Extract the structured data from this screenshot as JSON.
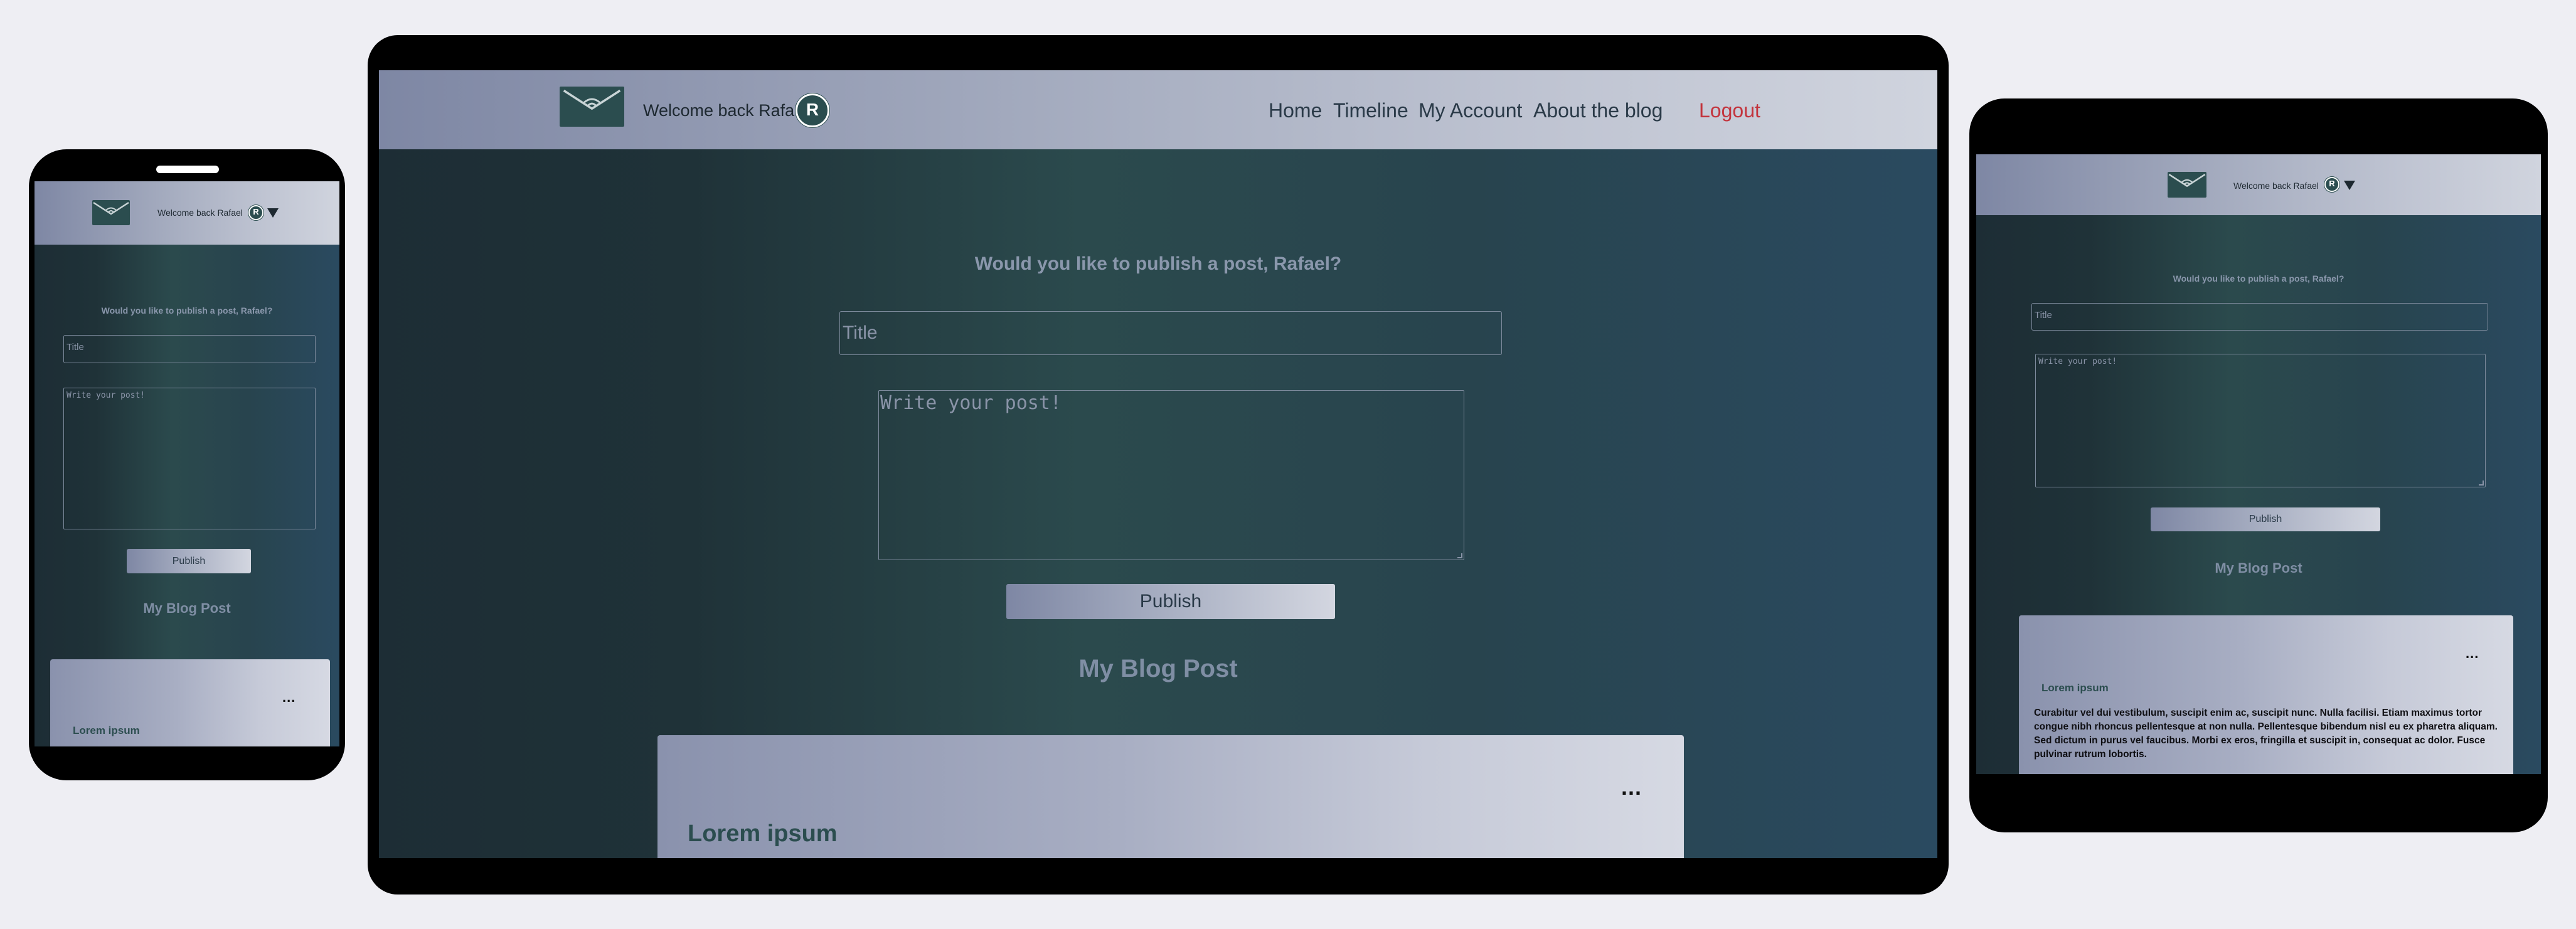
{
  "header": {
    "welcome": "Welcome back Rafael",
    "avatar_initial": "R",
    "nav": [
      "Home",
      "Timeline",
      "My Account",
      "About the blog"
    ],
    "logout": "Logout"
  },
  "form": {
    "question": "Would you like to publish a post, Rafael?",
    "title_placeholder": "Title",
    "post_placeholder": "Write your post!",
    "publish_label": "Publish"
  },
  "section": {
    "title": "My Blog Post"
  },
  "post": {
    "menu": "...",
    "title": "Lorem ipsum",
    "body": "Curabitur vel dui vestibulum, suscipit enim ac, suscipit nunc. Nulla facilisi. Etiam maximus tortor congue nibh rhoncus pellentesque at non nulla. Pellentesque bibendum nisl eu ex pharetra aliquam. Sed dictum in purus vel faucibus. Morbi ex eros, fringilla et suscipit in, consequat ac dolor. Fusce pulvinar rutrum lobortis."
  },
  "colors": {
    "accent": "#2b4d4f",
    "logout": "#c3343d",
    "frame": "#000000",
    "page": "#eeeef3"
  }
}
